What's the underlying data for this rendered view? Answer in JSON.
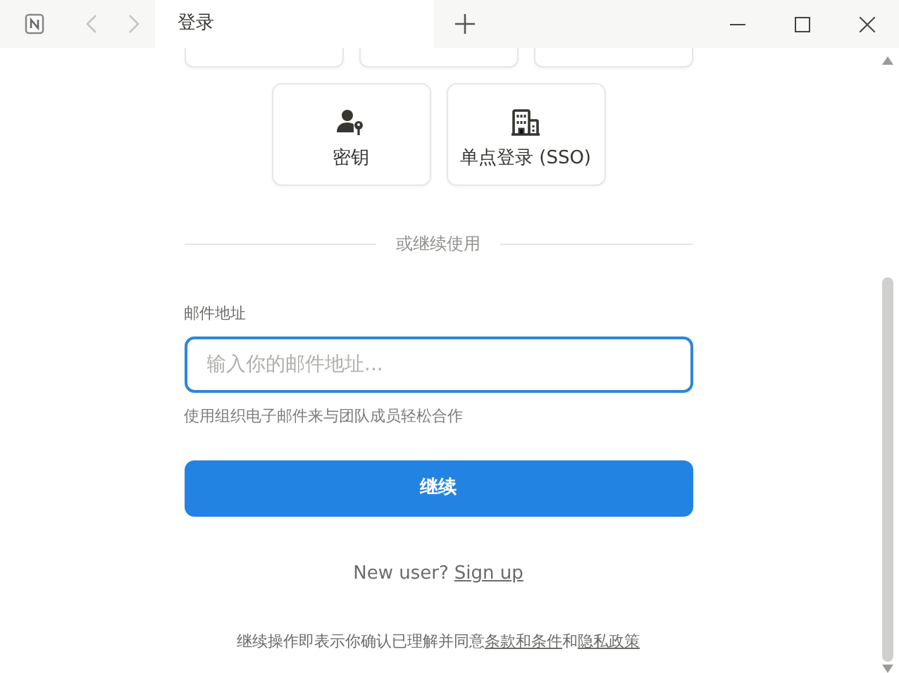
{
  "tab": {
    "title": "登录",
    "selected": true
  },
  "nav": {
    "back_disabled": true,
    "forward_disabled": true
  },
  "login_options": [
    {
      "kind": "passkey",
      "label": "密钥"
    },
    {
      "kind": "sso",
      "label": "单点登录 (SSO)"
    }
  ],
  "divider_text": "或继续使用",
  "email": {
    "label": "邮件地址",
    "placeholder": "输入你的邮件地址...",
    "hint": "使用组织电子邮件来与团队成员轻松合作",
    "focused": true
  },
  "continue_button": "继续",
  "signup": {
    "prompt": "New user?",
    "link": "Sign up"
  },
  "legal": {
    "text": "继续操作即表示你确认已理解并同意",
    "terms_link": "条款和条件",
    "joiner": "和",
    "privacy_link": "隐私政策"
  }
}
